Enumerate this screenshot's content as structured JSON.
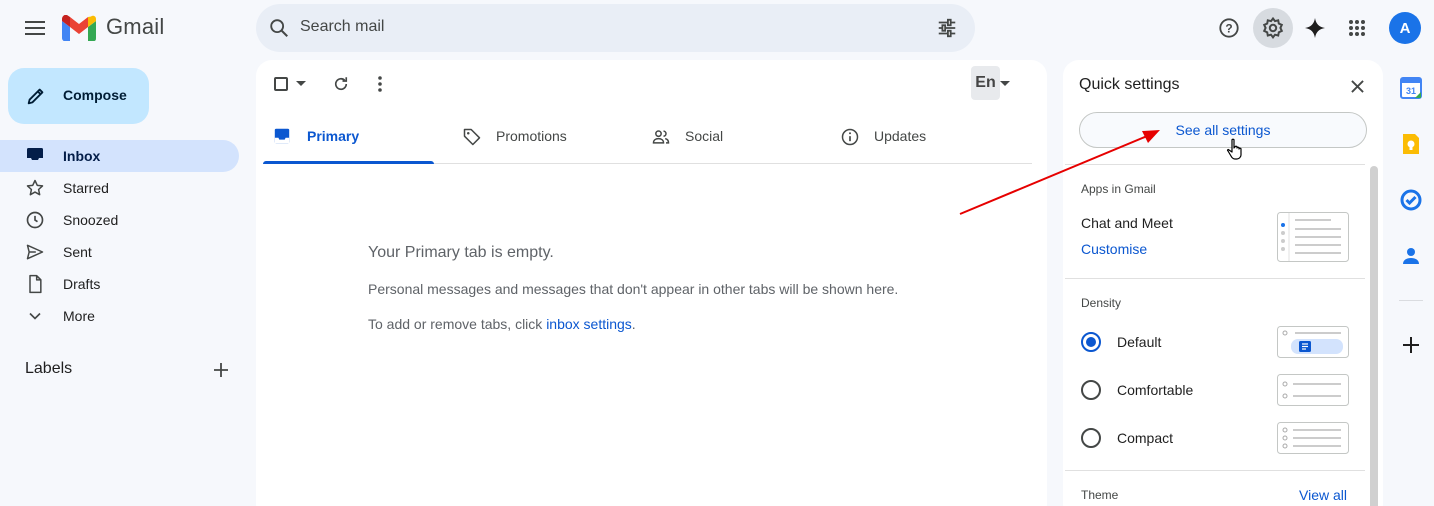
{
  "header": {
    "app_name": "Gmail",
    "search_placeholder": "Search mail",
    "avatar_letter": "A",
    "icons": [
      "menu-icon",
      "gmail-logo-icon",
      "search-icon",
      "search-options-icon",
      "help-icon",
      "settings-icon",
      "gemini-icon",
      "apps-icon"
    ],
    "colors": {
      "accent": "#0b57d0",
      "avatar": "#1a73e8"
    }
  },
  "sidebar": {
    "compose_label": "Compose",
    "items": [
      {
        "label": "Inbox",
        "icon": "inbox-icon",
        "active": true
      },
      {
        "label": "Starred",
        "icon": "star-icon"
      },
      {
        "label": "Snoozed",
        "icon": "clock-icon"
      },
      {
        "label": "Sent",
        "icon": "send-icon"
      },
      {
        "label": "Drafts",
        "icon": "draft-icon"
      },
      {
        "label": "More",
        "icon": "chevron-down-icon"
      }
    ],
    "labels_heading": "Labels"
  },
  "toolbar": {
    "lang_label": "En"
  },
  "tabs": [
    {
      "label": "Primary",
      "icon": "inbox-tab-icon",
      "active": true
    },
    {
      "label": "Promotions",
      "icon": "tag-icon"
    },
    {
      "label": "Social",
      "icon": "people-icon"
    },
    {
      "label": "Updates",
      "icon": "info-icon"
    }
  ],
  "empty_state": {
    "title": "Your Primary tab is empty.",
    "description": "Personal messages and messages that don't appear in other tabs will be shown here.",
    "hint_prefix": "To add or remove tabs, click ",
    "hint_link": "inbox settings",
    "hint_suffix": "."
  },
  "quick_settings": {
    "title": "Quick settings",
    "see_all": "See all settings",
    "apps_heading": "Apps in Gmail",
    "chat_meet_label": "Chat and Meet",
    "customise_link": "Customise",
    "density_heading": "Density",
    "density_options": [
      {
        "label": "Default",
        "selected": true
      },
      {
        "label": "Comfortable",
        "selected": false
      },
      {
        "label": "Compact",
        "selected": false
      }
    ],
    "theme_heading": "Theme",
    "view_all_link": "View all"
  },
  "right_rail": {
    "icons": [
      "calendar-icon",
      "keep-icon",
      "tasks-icon",
      "contacts-icon",
      "add-icon"
    ],
    "calendar_day": "31"
  }
}
